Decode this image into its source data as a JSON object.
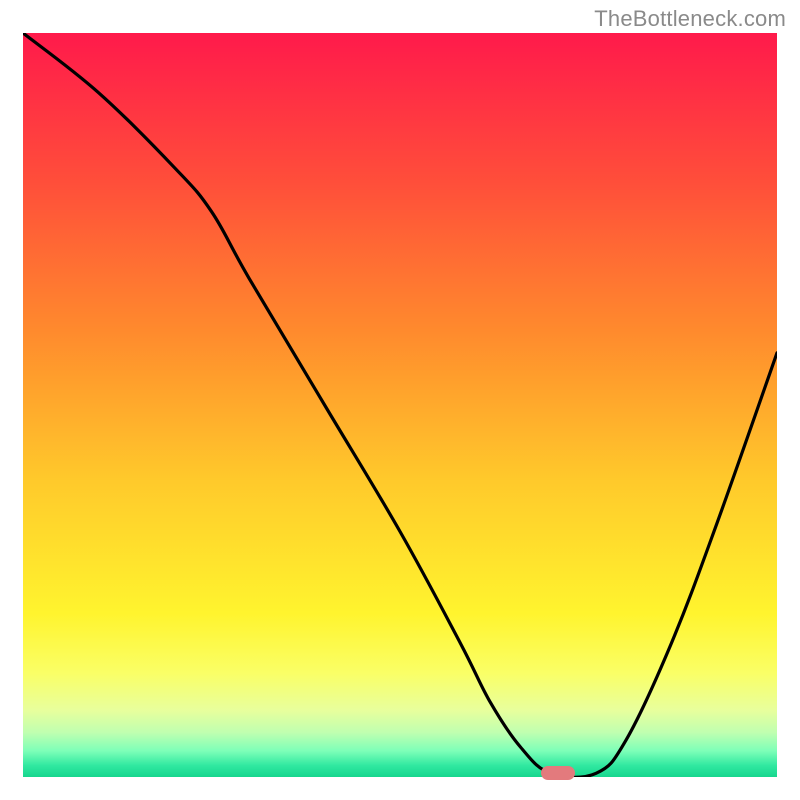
{
  "watermark": "TheBottleneck.com",
  "colors": {
    "frame": "#000000",
    "curve": "#000000",
    "marker": "#e37a7d",
    "gradient_stops": [
      {
        "offset": 0.0,
        "color": "#ff1a4b"
      },
      {
        "offset": 0.2,
        "color": "#ff4e3a"
      },
      {
        "offset": 0.4,
        "color": "#ff8a2d"
      },
      {
        "offset": 0.6,
        "color": "#ffc92b"
      },
      {
        "offset": 0.78,
        "color": "#fff42e"
      },
      {
        "offset": 0.86,
        "color": "#faff66"
      },
      {
        "offset": 0.91,
        "color": "#e8ff9c"
      },
      {
        "offset": 0.94,
        "color": "#c0ffb0"
      },
      {
        "offset": 0.965,
        "color": "#7dffb8"
      },
      {
        "offset": 0.985,
        "color": "#2fe8a0"
      },
      {
        "offset": 1.0,
        "color": "#17d68e"
      }
    ]
  },
  "chart_data": {
    "type": "line",
    "title": "",
    "xlabel": "",
    "ylabel": "",
    "xlim": [
      0,
      100
    ],
    "ylim": [
      0,
      100
    ],
    "x": [
      0,
      10,
      20,
      25,
      30,
      40,
      50,
      58,
      62,
      66,
      70,
      76,
      80,
      86,
      92,
      100
    ],
    "values": [
      100,
      92,
      82,
      76,
      67,
      50,
      33,
      18,
      10,
      4,
      0.5,
      0.5,
      5,
      18,
      34,
      57
    ],
    "marker": {
      "x": 71,
      "y": 0.5
    },
    "annotations": []
  }
}
